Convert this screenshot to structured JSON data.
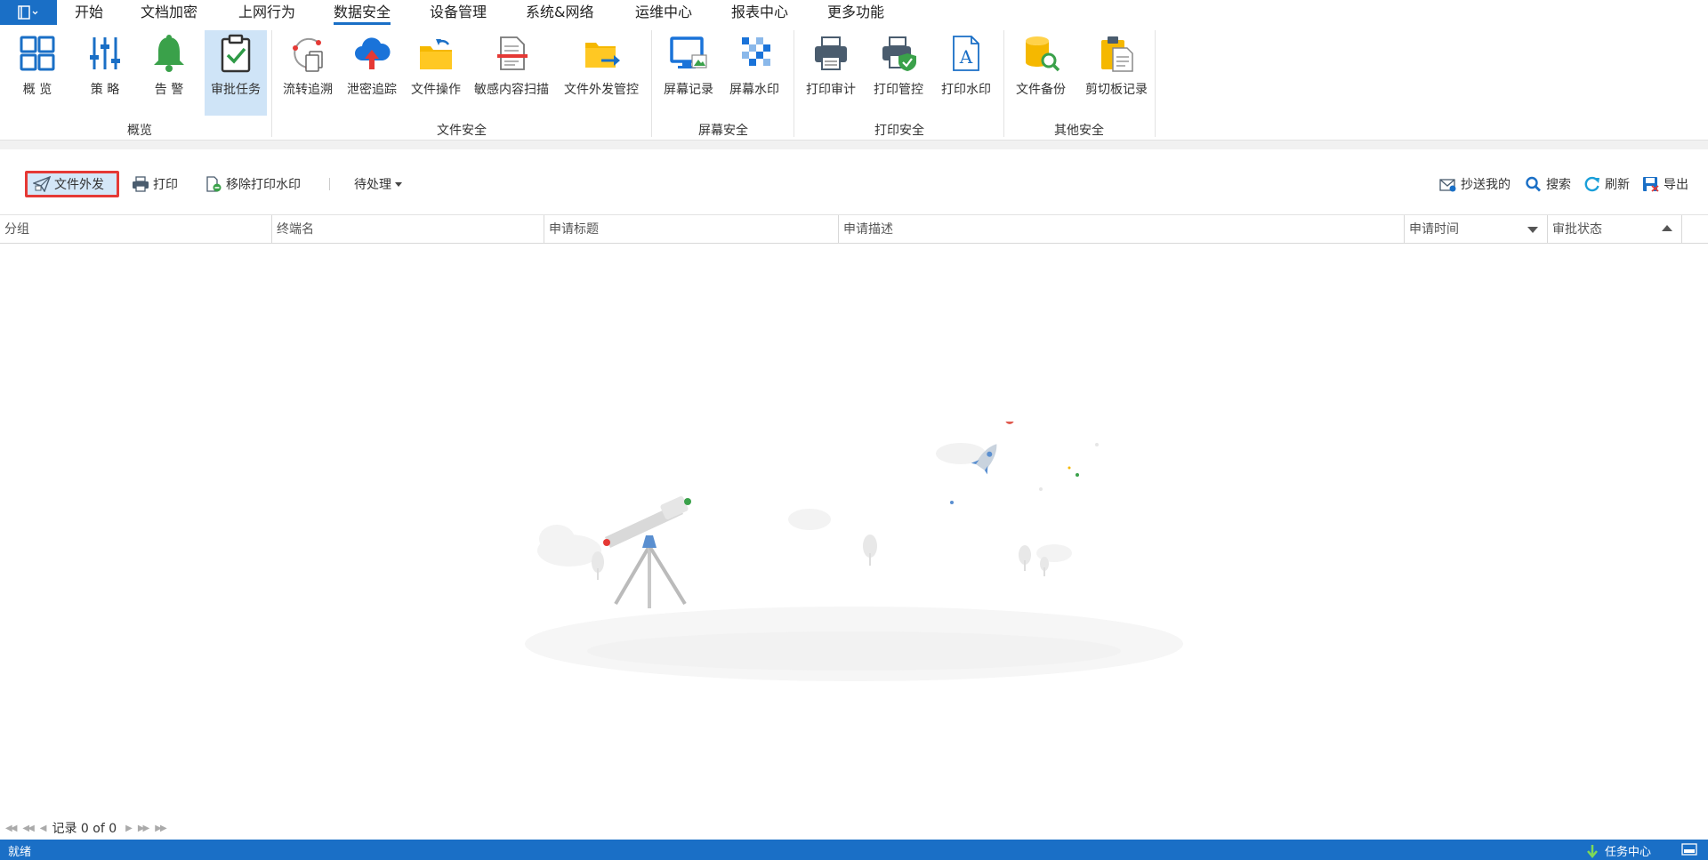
{
  "menu": {
    "tabs": [
      "开始",
      "文档加密",
      "上网行为",
      "数据安全",
      "设备管理",
      "系统&网络",
      "运维中心",
      "报表中心",
      "更多功能"
    ],
    "active_tab": "数据安全"
  },
  "ribbon": {
    "groups": [
      {
        "label": "概览",
        "buttons": [
          {
            "label": "概 览",
            "icon": "overview-icon"
          },
          {
            "label": "策 略",
            "icon": "sliders-icon"
          },
          {
            "label": "告 警",
            "icon": "bell-icon"
          },
          {
            "label": "审批任务",
            "icon": "approval-clipboard-icon",
            "selected": true
          }
        ]
      },
      {
        "label": "文件安全",
        "buttons": [
          {
            "label": "流转追溯",
            "icon": "file-trace-icon"
          },
          {
            "label": "泄密追踪",
            "icon": "cloud-upload-icon"
          },
          {
            "label": "文件操作",
            "icon": "folder-operation-icon"
          },
          {
            "label": "敏感内容扫描",
            "icon": "document-scan-icon"
          },
          {
            "label": "文件外发管控",
            "icon": "folder-send-icon"
          }
        ]
      },
      {
        "label": "屏幕安全",
        "buttons": [
          {
            "label": "屏幕记录",
            "icon": "monitor-record-icon"
          },
          {
            "label": "屏幕水印",
            "icon": "watermark-icon"
          }
        ]
      },
      {
        "label": "打印安全",
        "buttons": [
          {
            "label": "打印审计",
            "icon": "printer-icon"
          },
          {
            "label": "打印管控",
            "icon": "printer-shield-icon"
          },
          {
            "label": "打印水印",
            "icon": "text-document-icon"
          }
        ]
      },
      {
        "label": "其他安全",
        "buttons": [
          {
            "label": "文件备份",
            "icon": "backup-database-icon"
          },
          {
            "label": "剪切板记录",
            "icon": "clipboard-icon"
          }
        ]
      }
    ]
  },
  "toolbar": {
    "send_label": "文件外发",
    "print_label": "打印",
    "remove_watermark_label": "移除打印水印",
    "filter_label": "待处理",
    "cc_label": "抄送我的",
    "search_label": "搜索",
    "refresh_label": "刷新",
    "export_label": "导出"
  },
  "grid": {
    "columns": [
      "分组",
      "终端名",
      "申请标题",
      "申请描述",
      "申请时间",
      "审批状态"
    ]
  },
  "pager": {
    "text": "记录 0 of 0"
  },
  "status": {
    "text": "就绪",
    "task_center": "任务中心"
  },
  "colors": {
    "accent": "#1a6fc6",
    "highlight_border": "#e53935",
    "selected_bg": "#cfe4f7"
  }
}
